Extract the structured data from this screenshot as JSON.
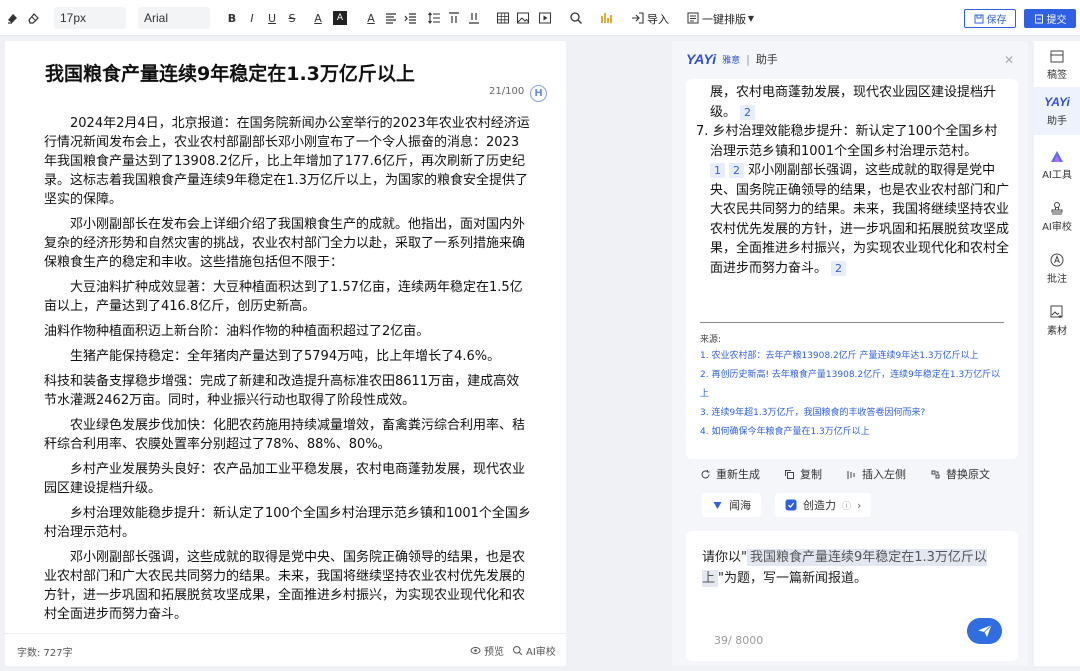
{
  "toolbar": {
    "font_size": "17px",
    "font_family": "Arial",
    "import_label": "导入",
    "layout_label": "一键排版",
    "save_label": "保存",
    "submit_label": "提交"
  },
  "doc": {
    "title": "我国粮食产量连续9年稳定在1.3万亿斤以上",
    "count": "21/100",
    "logo": "H",
    "paragraphs": [
      "2024年2月4日，北京报道：在国务院新闻办公室举行的2023年农业农村经济运行情况新闻发布会上，农业农村部副部长邓小刚宣布了一个令人振奋的消息：2023年我国粮食产量达到了13908.2亿斤，比上年增加了177.6亿斤，再次刷新了历史纪录。这标志着我国粮食产量连续9年稳定在1.3万亿斤以上，为国家的粮食安全提供了坚实的保障。",
      "邓小刚副部长在发布会上详细介绍了我国粮食生产的成就。他指出，面对国内外复杂的经济形势和自然灾害的挑战，农业农村部门全力以赴，采取了一系列措施来确保粮食生产的稳定和丰收。这些措施包括但不限于：",
      "大豆油料扩种成效显著：大豆种植面积达到了1.57亿亩，连续两年稳定在1.5亿亩以上，产量达到了416.8亿斤，创历史新高。",
      "油料作物种植面积迈上新台阶：油料作物的种植面积超过了2亿亩。",
      "生猪产能保持稳定：全年猪肉产量达到了5794万吨，比上年增长了4.6%。",
      "科技和装备支撑稳步增强：完成了新建和改造提升高标准农田8611万亩，建成高效节水灌溉2462万亩。同时，种业振兴行动也取得了阶段性成效。",
      "农业绿色发展步伐加快：化肥农药施用持续减量增效，畜禽粪污综合利用率、秸秆综合利用率、农膜处置率分别超过了78%、88%、80%。",
      "乡村产业发展势头良好：农产品加工业平稳发展，农村电商蓬勃发展，现代农业园区建设提档升级。",
      "乡村治理效能稳步提升：新认定了100个全国乡村治理示范乡镇和1001个全国乡村治理示范村。",
      "邓小刚副部长强调，这些成就的取得是党中央、国务院正确领导的结果，也是农业农村部门和广大农民共同努力的结果。未来，我国将继续坚持农业农村优先发展的方针，进一步巩固和拓展脱贫攻坚成果，全面推进乡村振兴，为实现农业现代化和农村全面进步而努力奋斗。"
    ],
    "footer_count": "字数: 727字",
    "preview_label": "预览",
    "ai_review_label": "AI审校"
  },
  "assistant": {
    "brand": "YAYi",
    "brand_sub": "雅意",
    "separator": "|",
    "title": "助手",
    "answer_line1": "展，农村电商蓬勃发展，现代农业园区建设提档升级。",
    "ref_2": "2",
    "answer_item7": "7. 乡村治理效能稳步提升：新认定了100个全国乡村治理示范乡镇和1001个全国乡村治理示范村。",
    "ref_1": "1",
    "answer_para": "邓小刚副部长强调，这些成就的取得是党中央、国务院正确领导的结果，也是农业农村部门和广大农民共同努力的结果。未来，我国将继续坚持农业农村优先发展的方针，进一步巩固和拓展脱贫攻坚成果，全面推进乡村振兴，为实现农业现代化和农村全面进步而努力奋斗。",
    "sources_label": "来源:",
    "sources": [
      "1. 农业农村部：去年产粮13908.2亿斤 产量连续9年达1.3万亿斤以上",
      "2. 再创历史新高! 去年粮食产量13908.2亿斤，连续9年稳定在1.3万亿斤以上",
      "3. 连续9年超1.3万亿斤，我国粮食的丰收答卷因何而来?",
      "4. 如何确保今年粮食产量在1.3万亿斤以上"
    ],
    "actions": [
      "重新生成",
      "复制",
      "插入左侧",
      "替换原文"
    ],
    "chip1": "闻海",
    "chip2": "创造力",
    "prompt_prefix": "请你以\"",
    "prompt_highlight": "我国粮食产量连续9年稳定在1.3万亿斤以上",
    "prompt_suffix": "\"为题，写一篇新闻报道。",
    "input_count": "39/ 8000"
  },
  "sidebar": [
    "稿签",
    "助手",
    "AI工具",
    "AI审校",
    "批注",
    "素材"
  ],
  "colors": {
    "accent": "#2f5fe3",
    "ref_bg": "#e8edfb"
  }
}
